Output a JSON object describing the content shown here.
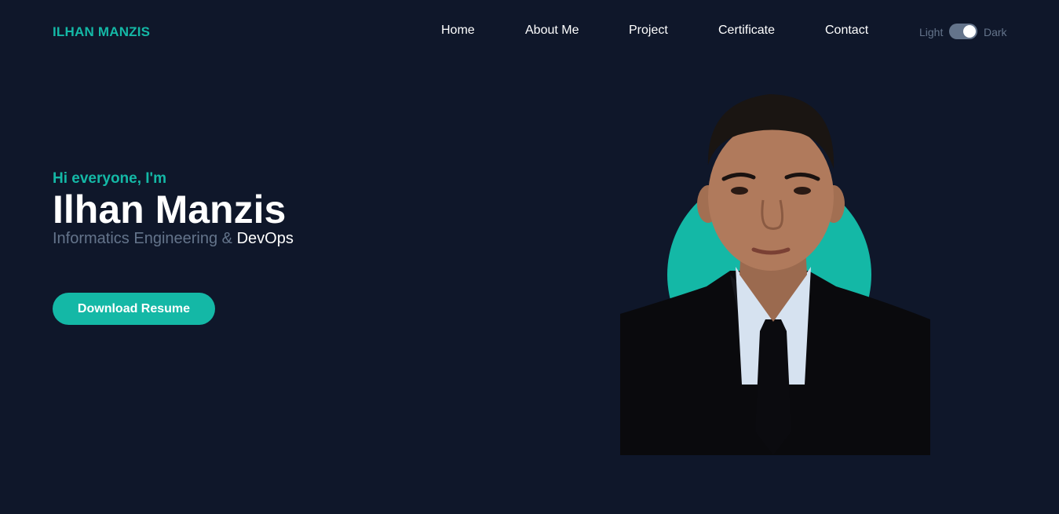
{
  "header": {
    "logo": "ILHAN MANZIS",
    "nav": [
      {
        "label": "Home"
      },
      {
        "label": "About Me"
      },
      {
        "label": "Project"
      },
      {
        "label": "Certificate"
      },
      {
        "label": "Contact"
      }
    ],
    "theme": {
      "light_label": "Light",
      "dark_label": "Dark",
      "selected": "Dark"
    }
  },
  "hero": {
    "greeting": "Hi everyone, I'm",
    "name": "Ilhan Manzis",
    "subtitle_prefix": "Informatics Engineering &",
    "subtitle_highlight": "DevOps",
    "cta_label": "Download Resume",
    "photo": "portrait-photo"
  },
  "colors": {
    "background": "#0f172a",
    "accent": "#14b8a6",
    "muted": "#64748b",
    "text": "#ffffff"
  }
}
